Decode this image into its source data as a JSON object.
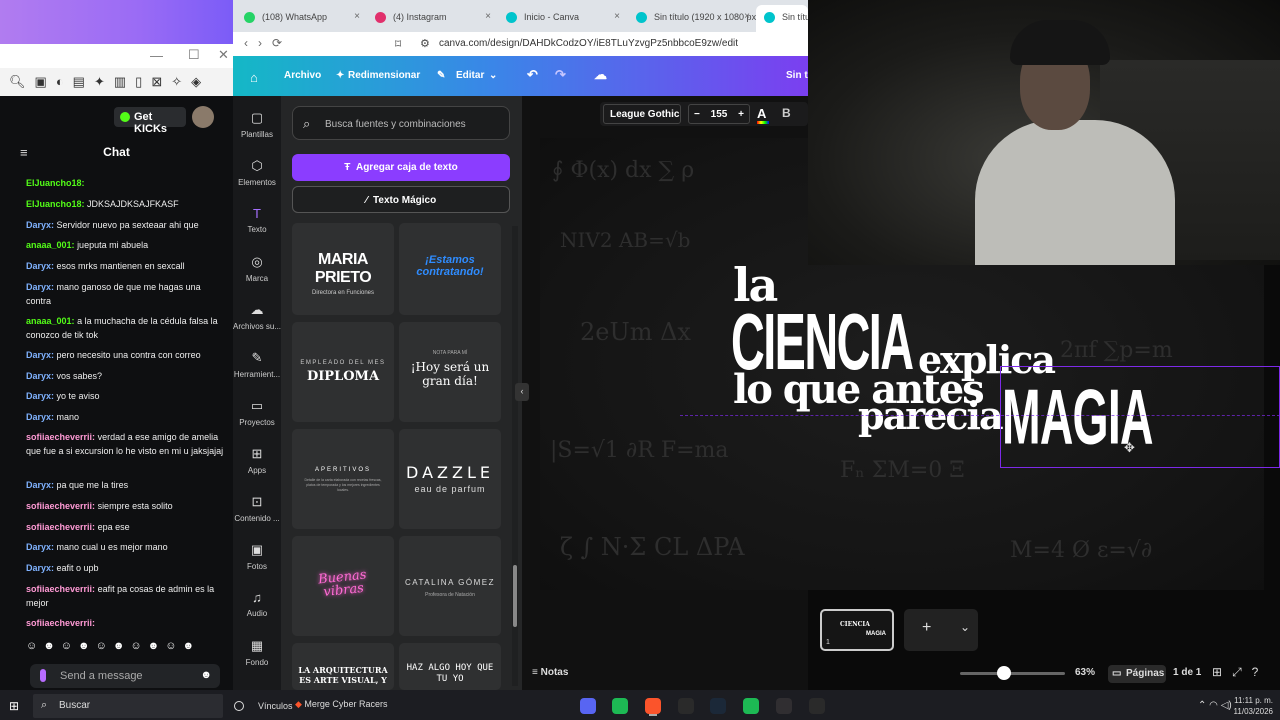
{
  "left_window": {
    "chat_title": "Chat",
    "get_kicks_label": "Get KICKs",
    "send_placeholder": "Send a message",
    "messages": [
      {
        "user": "ElJuancho18:",
        "text": "",
        "color": "#53fc18"
      },
      {
        "user": "ElJuancho18:",
        "text": "JDKSAJDKSAJFKASF",
        "color": "#53fc18"
      },
      {
        "user": "Daryx:",
        "text": "Servidor nuevo pa sexteaar ahi que",
        "color": "#7fb2ff"
      },
      {
        "user": "anaaa_001:",
        "text": "jueputa mi abuela",
        "color": "#53fc18"
      },
      {
        "user": "Daryx:",
        "text": "esos mrks mantienen en sexcall",
        "color": "#7fb2ff"
      },
      {
        "user": "Daryx:",
        "text": "mano ganoso de que me hagas una contra",
        "color": "#7fb2ff"
      },
      {
        "user": "anaaa_001:",
        "text": "a la muchacha de la cédula falsa la conozco de tik tok",
        "color": "#53fc18"
      },
      {
        "user": "Daryx:",
        "text": "pero necesito una contra con correo",
        "color": "#7fb2ff"
      },
      {
        "user": "Daryx:",
        "text": "vos sabes?",
        "color": "#7fb2ff"
      },
      {
        "user": "Daryx:",
        "text": "yo te aviso",
        "color": "#7fb2ff"
      },
      {
        "user": "Daryx:",
        "text": "mano",
        "color": "#7fb2ff"
      },
      {
        "user": "sofiiaecheverrii:",
        "text": "verdad a ese amigo de amelia que fue a si excursion lo he visto en mi u jaksjajaj",
        "color": "#ff9ad5"
      },
      {
        "user": "Daryx:",
        "text": "pa que me la tires",
        "color": "#7fb2ff"
      },
      {
        "user": "sofiiaecheverrii:",
        "text": "siempre esta solito",
        "color": "#ff9ad5"
      },
      {
        "user": "sofiiaecheverrii:",
        "text": "epa ese",
        "color": "#ff9ad5"
      },
      {
        "user": "Daryx:",
        "text": "mano cual u es mejor mano",
        "color": "#7fb2ff"
      },
      {
        "user": "Daryx:",
        "text": "eafit o upb",
        "color": "#7fb2ff"
      },
      {
        "user": "sofiiaecheverrii:",
        "text": "eafit pa cosas de admin es la mejor",
        "color": "#ff9ad5"
      },
      {
        "user": "sofiiaecheverrii:",
        "text": "",
        "color": "#ff9ad5"
      }
    ]
  },
  "browser": {
    "tabs": [
      {
        "label": "(108) WhatsApp",
        "color": "#25d366"
      },
      {
        "label": "(4) Instagram",
        "color": "#e1306c"
      },
      {
        "label": "Inicio - Canva",
        "color": "#00c4cc"
      },
      {
        "label": "Sin título (1920 x 1080 px)",
        "color": "#00c4cc"
      },
      {
        "label": "Sin títu",
        "color": "#00c4cc"
      }
    ],
    "url": "canva.com/design/DAHDkCodzOY/iE8TLuYzvgPz5nbbcoE9zw/edit"
  },
  "canva": {
    "topbar": {
      "archivo": "Archivo",
      "redimensionar": "Redimensionar",
      "editar": "Editar",
      "title_fragment": "Sin ti"
    },
    "rail": [
      {
        "label": "Plantillas",
        "icon": "▢"
      },
      {
        "label": "Elementos",
        "icon": "⬡"
      },
      {
        "label": "Texto",
        "icon": "T"
      },
      {
        "label": "Marca",
        "icon": "◎"
      },
      {
        "label": "Archivos su...",
        "icon": "☁"
      },
      {
        "label": "Herramient...",
        "icon": "✎"
      },
      {
        "label": "Proyectos",
        "icon": "▭"
      },
      {
        "label": "Apps",
        "icon": "⊞"
      },
      {
        "label": "Contenido ...",
        "icon": "⊡"
      },
      {
        "label": "Fotos",
        "icon": "▣"
      },
      {
        "label": "Audio",
        "icon": "♫"
      },
      {
        "label": "Fondo",
        "icon": "▦"
      }
    ],
    "search_placeholder": "Busca fuentes y combinaciones",
    "add_text_label": "Agregar caja de texto",
    "magic_text_label": "Texto Mágico",
    "templates": {
      "maria_title": "MARIA PRIETO",
      "maria_sub": "Directora en Funciones",
      "estamos": "¡Estamos contratando!",
      "empleado": "EMPLEADO DEL MES",
      "diploma": "DIPLOMA",
      "nota": "NOTA PARA MÍ",
      "hoy": "¡Hoy será un gran día!",
      "aperitivos": "APERITIVOS",
      "aperitivos_sub": "Detalle de la carta elaborada con recetas frescas, platos de temporada y los mejores ingredientes locales.",
      "dazzle": "DAZZLE",
      "dazzle_sub": "eau de parfum",
      "buenas": "Buenas vibras",
      "catalina": "CATALINA GÓMEZ",
      "catalina_sub": "Profesora de Natación",
      "arquitectura": "LA ARQUITECTURA ES ARTE VISUAL, Y",
      "haz": "HAZ ALGO HOY QUE TU YO"
    },
    "font_toolbar": {
      "font": "League Gothic",
      "size": "155",
      "color_letter": "A",
      "bold": "B"
    },
    "design": {
      "la": "la",
      "ciencia": "CIENCIA",
      "explica": "explica",
      "lo_que_antes": "lo que antes",
      "parecia": "parecia",
      "magia": "MAGIA"
    },
    "bottom": {
      "notas": "Notas",
      "zoom": "63%",
      "zoom_fraction": 0.42,
      "paginas": "Páginas",
      "page_count": "1 de 1",
      "thumb_number": "1"
    }
  },
  "taskbar": {
    "search": "Buscar",
    "vinculos": "Vínculos",
    "merge": "Merge Cyber Racers",
    "time": "11:11 p. m.",
    "date": "11/03/2026",
    "apps": [
      {
        "name": "discord-icon",
        "color": "#5865f2"
      },
      {
        "name": "spotify-icon",
        "color": "#1db954"
      },
      {
        "name": "brave-icon",
        "color": "#fb542b"
      },
      {
        "name": "epic-icon",
        "color": "#2a2a2a"
      },
      {
        "name": "steam-icon",
        "color": "#1b2838"
      },
      {
        "name": "spotify2-icon",
        "color": "#1db954"
      },
      {
        "name": "obs-icon",
        "color": "#302e31"
      },
      {
        "name": "epic2-icon",
        "color": "#2a2a2a"
      }
    ]
  }
}
